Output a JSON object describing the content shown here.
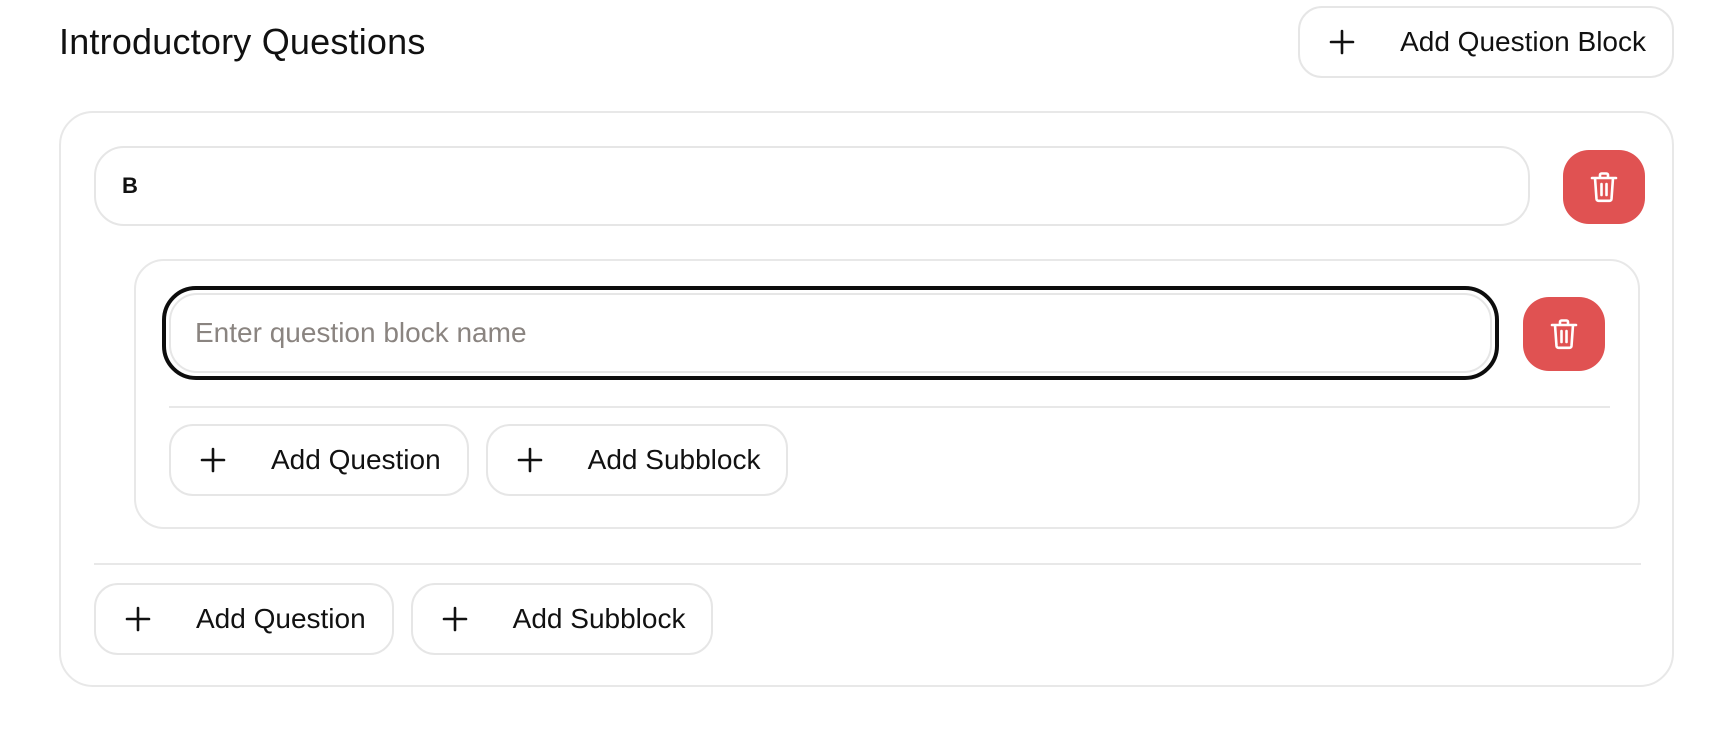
{
  "section": {
    "title": "Introductory Questions",
    "add_block_label": "Add Question Block"
  },
  "block": {
    "name_value": "B",
    "add_question_label": "Add Question",
    "add_subblock_label": "Add Subblock",
    "subblock": {
      "name_value": "",
      "name_placeholder": "Enter question block name",
      "add_question_label": "Add Question",
      "add_subblock_label": "Add Subblock"
    }
  },
  "icons": {
    "plus": "plus-icon",
    "delete": "trash-icon"
  },
  "colors": {
    "danger": "#e05252",
    "border": "#e6e6e6",
    "focus": "#0d0d0d",
    "placeholder": "#8a8480"
  }
}
